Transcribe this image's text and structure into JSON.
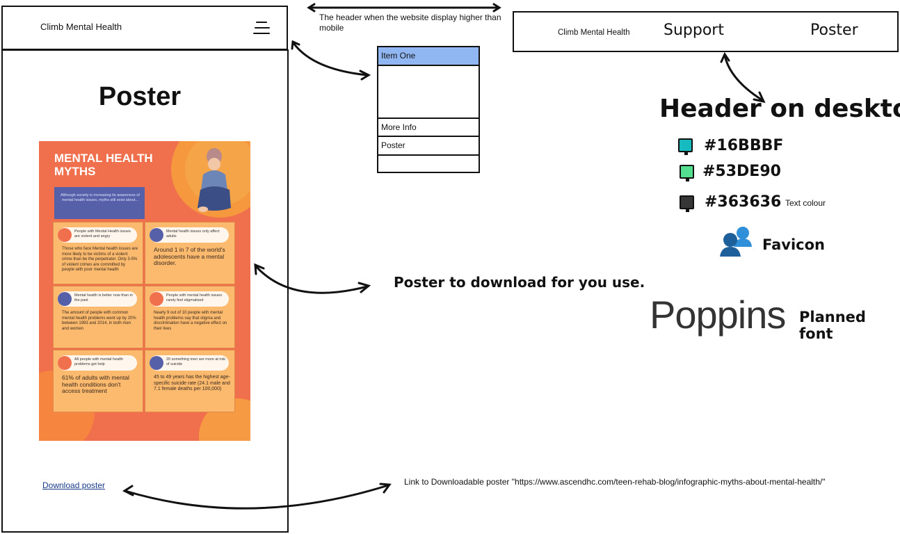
{
  "mobile_header": {
    "brand": "Climb Mental Health"
  },
  "mobile_page": {
    "title": "Poster",
    "download_link": "Download poster"
  },
  "poster": {
    "title": "MENTAL HEALTH MYTHS",
    "intro": "Although society is increasing its awareness of mental health issues, myths still exist about...",
    "cells": [
      {
        "pill": "People with Mental Health issues are violent and angry",
        "text": "Those who face Mental health issues are more likely to be victims of a violent crime than be the perpetrator. Only 3-5% of violent crimes are committed by people with poor mental health",
        "dot": "#f0704e"
      },
      {
        "pill": "Mental health issues only affect adults",
        "text": "Around 1 in 7 of the world's adolescents have a mental disorder.",
        "dot": "#5660a8"
      },
      {
        "pill": "Mental health is better now than in the past",
        "text": "The amount of people with common mental health problems went up by 20% between 1993 and 2014, in both men and women",
        "dot": "#5660a8"
      },
      {
        "pill": "People with mental health issues rarely feel stigmatised",
        "text": "Nearly 9 out of 10 people with mental health problems say that stigma and discrimination have a negative effect on their lives",
        "dot": "#f0704e"
      },
      {
        "pill": "All people with mental health problems get help",
        "text": "61% of adults with mental health conditions don't access treatment",
        "dot": "#f0704e"
      },
      {
        "pill": "20 something men are more at risk of suicide",
        "text": "45 to 49 years has the highest age-specific suicide rate (24.1 male and 7.1 female deaths per 100,000)",
        "dot": "#5660a8"
      }
    ]
  },
  "menu": {
    "items": [
      "Item One",
      "",
      "More Info",
      "Poster"
    ]
  },
  "notes": {
    "header_note": "The header when the website display higher than mobile",
    "poster_note": "Poster to download for you use.",
    "link_note": "Link to Downloadable poster \"https://www.ascendhc.com/teen-rehab-blog/infographic-myths-about-mental-health/\""
  },
  "desktop_header": {
    "brand": "Climb Mental Health",
    "nav": [
      "Support",
      "Poster"
    ]
  },
  "desktop_label": "Header on desktop",
  "colors": [
    {
      "hex": "#16BBBF",
      "label": "#16BBBF",
      "note": ""
    },
    {
      "hex": "#53DE90",
      "label": "#53DE90",
      "note": ""
    },
    {
      "hex": "#363636",
      "label": "#363636",
      "note": "Text colour"
    }
  ],
  "favicon": {
    "label": "Favicon",
    "icon": "users-icon"
  },
  "font": {
    "sample": "Poppins",
    "label": "Planned font"
  }
}
